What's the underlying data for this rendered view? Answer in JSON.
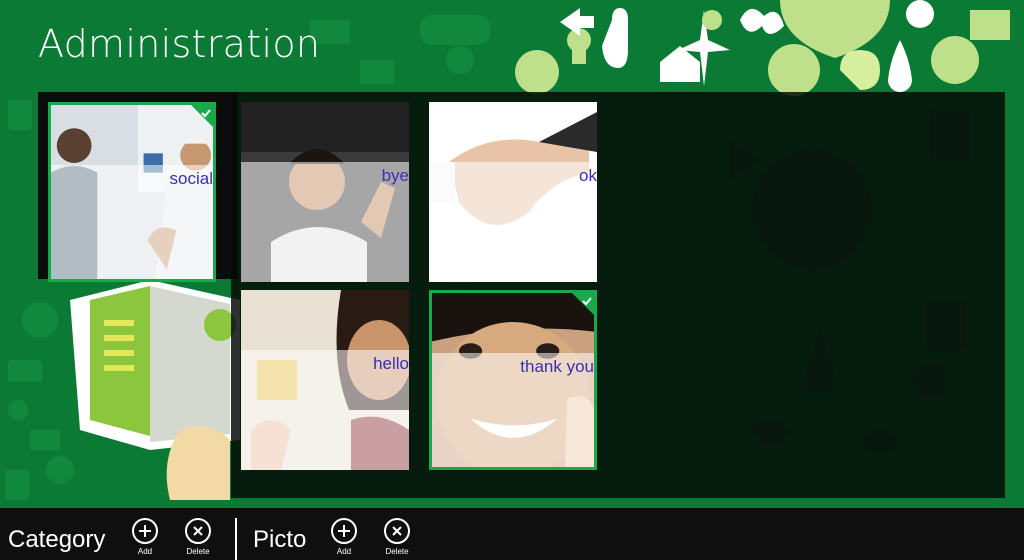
{
  "page": {
    "title": "Administration"
  },
  "theme": {
    "background_green": "#0b7a35",
    "icon_light_green": "#8cc63f",
    "panel_dark": "#0a0d0b",
    "tile_border_selected": "#17a94a",
    "label_color": "#3a2fb8"
  },
  "categories": [
    {
      "label": "social",
      "selected": true,
      "photo": "men-talking"
    }
  ],
  "pictos": [
    {
      "label": "bye",
      "selected": false,
      "photo": "boy-waving"
    },
    {
      "label": "ok",
      "selected": false,
      "photo": "handshake"
    },
    {
      "label": "hello",
      "selected": false,
      "photo": "woman-waving"
    },
    {
      "label": "thank you",
      "selected": true,
      "photo": "boy-smiling"
    }
  ],
  "app_bar": {
    "category_label": "Category",
    "picto_label": "Picto",
    "category_add": {
      "caption": "Add",
      "icon": "plus-icon"
    },
    "category_delete": {
      "caption": "Delete",
      "icon": "x-icon"
    },
    "picto_add": {
      "caption": "Add",
      "icon": "plus-icon"
    },
    "picto_delete": {
      "caption": "Delete",
      "icon": "x-icon"
    }
  }
}
